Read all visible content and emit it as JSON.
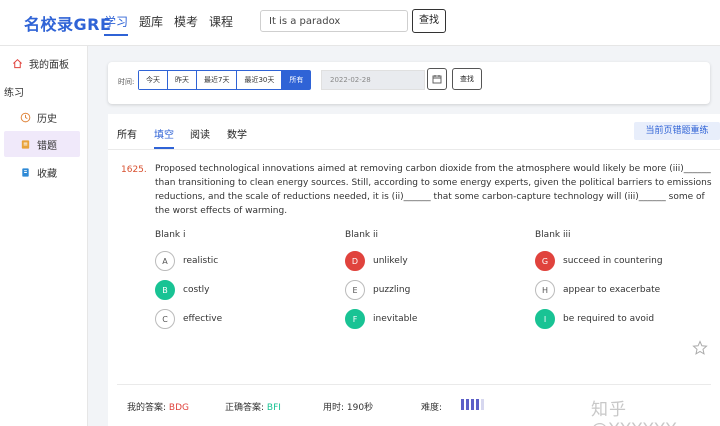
{
  "header": {
    "logo": "名校录GRE",
    "nav": [
      "学习",
      "题库",
      "模考",
      "课程"
    ],
    "search_value": "It is a paradox",
    "search_button": "查找"
  },
  "sidebar": {
    "dashboard": "我的面板",
    "section": "练习",
    "items": [
      {
        "label": "历史"
      },
      {
        "label": "错题"
      },
      {
        "label": "收藏"
      }
    ]
  },
  "filter": {
    "label": "时间:",
    "ranges": [
      "今天",
      "昨天",
      "最近7天",
      "最近30天",
      "所有"
    ],
    "active_range": "所有",
    "date_value": "2022-02-28",
    "find_button": "查找"
  },
  "tabs": [
    "所有",
    "填空",
    "阅读",
    "数学"
  ],
  "active_tab": "填空",
  "retrain_button": "当前页错题重练",
  "question": {
    "number": "1625.",
    "text": "Proposed technological innovations aimed at removing carbon dioxide from the atmosphere would likely be more (iii)______ than transitioning to clean energy sources. Still, according to some energy experts, given the political barriers to emissions reductions, and the scale of reductions needed, it is (ii)______ that some carbon-capture technology will (iii)______ some of the worst effects of warming.",
    "blanks": [
      {
        "title": "Blank i",
        "options": [
          {
            "letter": "A",
            "text": "realistic",
            "state": "none"
          },
          {
            "letter": "B",
            "text": "costly",
            "state": "correct"
          },
          {
            "letter": "C",
            "text": "effective",
            "state": "none"
          }
        ]
      },
      {
        "title": "Blank ii",
        "options": [
          {
            "letter": "D",
            "text": "unlikely",
            "state": "wrong"
          },
          {
            "letter": "E",
            "text": "puzzling",
            "state": "none"
          },
          {
            "letter": "F",
            "text": "inevitable",
            "state": "correct"
          }
        ]
      },
      {
        "title": "Blank iii",
        "options": [
          {
            "letter": "G",
            "text": "succeed in countering",
            "state": "wrong"
          },
          {
            "letter": "H",
            "text": "appear to exacerbate",
            "state": "none"
          },
          {
            "letter": "I",
            "text": "be required to avoid",
            "state": "correct"
          }
        ]
      }
    ]
  },
  "answers": {
    "mine_label": "我的答案:",
    "mine_value": "BDG",
    "correct_label": "正确答案:",
    "correct_value": "BFI",
    "time_label": "用时:",
    "time_value": "190秒",
    "difficulty_label": "难度:",
    "difficulty_level": 4,
    "difficulty_max": 5
  },
  "watermark": "知乎 @YYYYYY",
  "colors": {
    "accent": "#2f63d6",
    "wrong": "#e0433d",
    "correct": "#19c394",
    "selected_bg": "#f0e9fa"
  }
}
